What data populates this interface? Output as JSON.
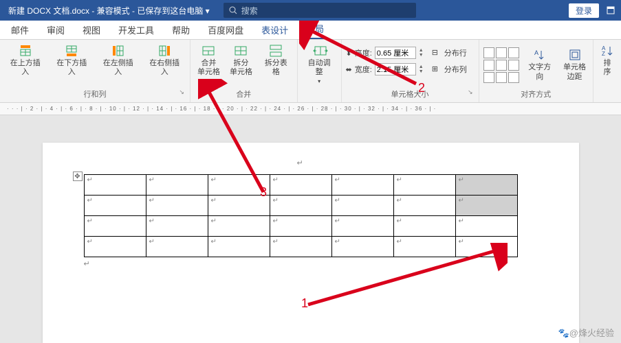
{
  "titlebar": {
    "doc_title": "新建 DOCX 文档.docx - 兼容模式 - 已保存到这台电脑 ▾",
    "search_placeholder": "搜索",
    "login": "登录"
  },
  "tabs": {
    "items": [
      "邮件",
      "审阅",
      "视图",
      "开发工具",
      "帮助",
      "百度网盘",
      "表设计",
      "布局"
    ],
    "active_index": 7,
    "blue_indices": [
      6,
      7
    ]
  },
  "ribbon": {
    "rows_cols": {
      "label": "行和列",
      "insert_above": "在上方插入",
      "insert_below": "在下方插入",
      "insert_left": "在左侧插入",
      "insert_right": "在右侧插入"
    },
    "merge": {
      "label": "合并",
      "merge_cells": "合并\n单元格",
      "split_cells": "拆分\n单元格",
      "split_table": "拆分表格"
    },
    "autofit": {
      "label": "自动调整"
    },
    "cell_size": {
      "label": "单元格大小",
      "height_label": "高度:",
      "height_value": "0.65 厘米",
      "width_label": "宽度:",
      "width_value": "2.15 厘米",
      "dist_rows": "分布行",
      "dist_cols": "分布列"
    },
    "alignment": {
      "label": "对齐方式",
      "text_dir": "文字方向",
      "cell_margin": "单元格\n边距"
    },
    "sort": {
      "label": "排\n序"
    }
  },
  "ruler_text": "· · · | · 2 · | · 4 · | · 6 · | · 8 · | · 10 · | · 12 · | · 14 · | · 16 · | · 18 · | · 20 · | · 22 · | · 24 · | · 26 · | · 28 · | · 30 · | · 32 · | · 34 · | · 36 · | ·",
  "annotations": {
    "a1": "1",
    "a2": "2",
    "a3": "3"
  },
  "watermark": "🐾@烽火经验",
  "chart_data": {
    "type": "table",
    "rows": 4,
    "cols": 7,
    "selected_cells": [
      [
        0,
        6
      ],
      [
        1,
        6
      ]
    ],
    "note": "Word table with last-column top two cells selected"
  }
}
